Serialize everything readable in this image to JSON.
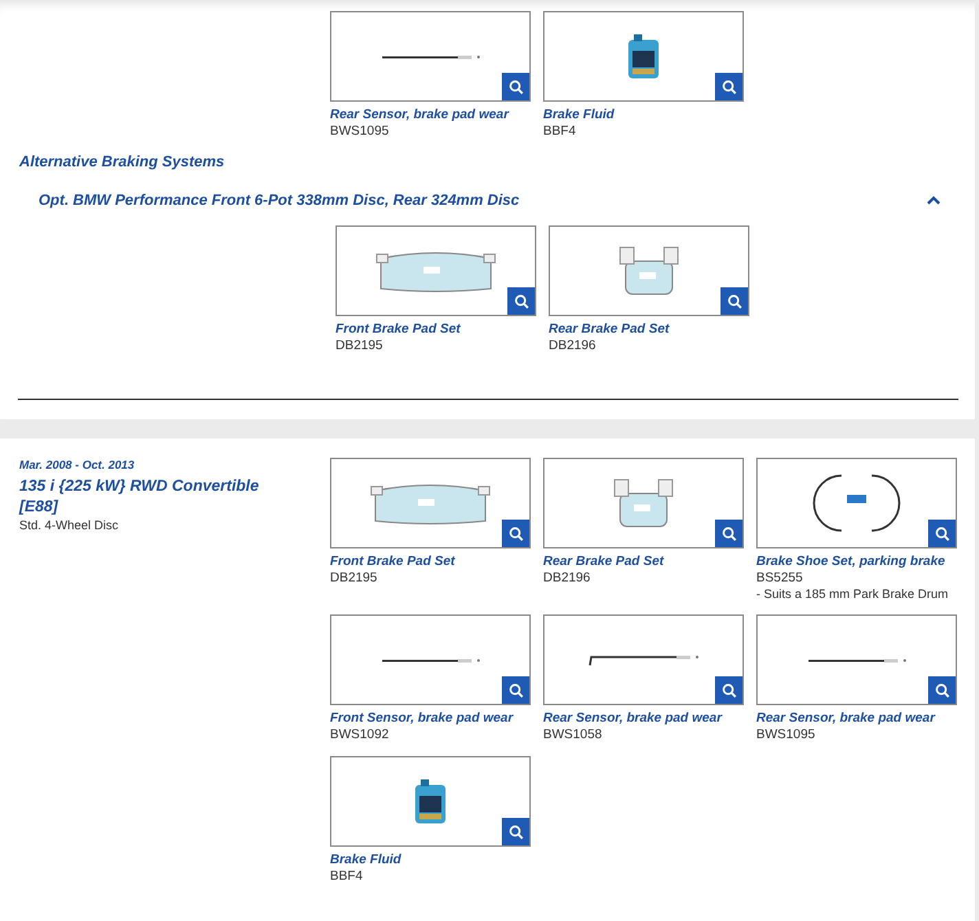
{
  "top_products": [
    {
      "name": "Rear Sensor, brake pad wear",
      "code": "BWS1095",
      "kind": "sensor"
    },
    {
      "name": "Brake Fluid",
      "code": "BBF4",
      "kind": "fluid"
    }
  ],
  "alternative": {
    "heading": "Alternative Braking Systems",
    "option": {
      "label": "Opt. BMW Performance Front 6-Pot 338mm Disc, Rear 324mm Disc",
      "expanded": true
    },
    "products": [
      {
        "name": "Front Brake Pad Set",
        "code": "DB2195",
        "kind": "pad-front"
      },
      {
        "name": "Rear Brake Pad Set",
        "code": "DB2196",
        "kind": "pad-rear"
      }
    ]
  },
  "vehicle": {
    "date_range": "Mar. 2008 - Oct. 2013",
    "title": "135 i {225 kW} RWD Convertible [E88]",
    "subtitle": "Std. 4-Wheel Disc",
    "products": [
      {
        "name": "Front Brake Pad Set",
        "code": "DB2195",
        "kind": "pad-front"
      },
      {
        "name": "Rear Brake Pad Set",
        "code": "DB2196",
        "kind": "pad-rear"
      },
      {
        "name": "Brake Shoe Set, parking brake",
        "code": "BS5255",
        "note": "- Suits a 185 mm Park Brake Drum",
        "kind": "shoe"
      },
      {
        "name": "Front Sensor, brake pad wear",
        "code": "BWS1092",
        "kind": "sensor"
      },
      {
        "name": "Rear Sensor, brake pad wear",
        "code": "BWS1058",
        "kind": "sensor-bent"
      },
      {
        "name": "Rear Sensor, brake pad wear",
        "code": "BWS1095",
        "kind": "sensor"
      },
      {
        "name": "Brake Fluid",
        "code": "BBF4",
        "kind": "fluid"
      }
    ]
  }
}
